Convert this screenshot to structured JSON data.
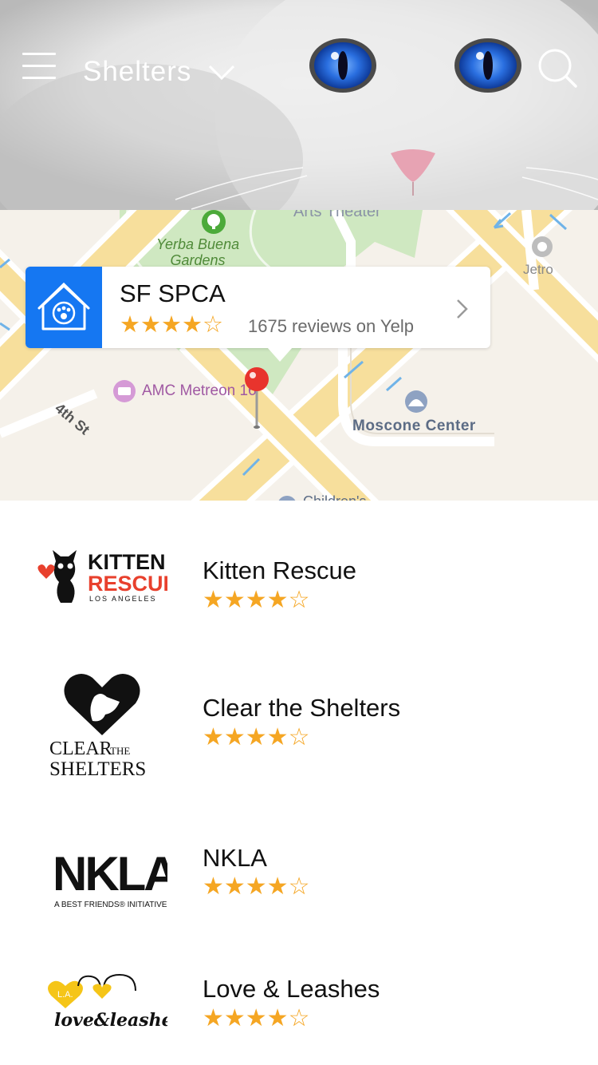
{
  "header": {
    "title": "Shelters"
  },
  "map": {
    "labels": {
      "arts": "Arts Theater",
      "yerba_line1": "Yerba Buena",
      "yerba_line2": "Gardens",
      "jetro": "Jetro",
      "amc": "AMC Metreon 16",
      "fourth_st": "4th St",
      "moscone": "Moscone Center",
      "child": "Children's"
    },
    "callout": {
      "name": "SF SPCA",
      "stars": "★★★★☆",
      "reviews": "1675 reviews on Yelp"
    }
  },
  "list": {
    "items": [
      {
        "name": "Kitten Rescue",
        "stars": "★★★★☆",
        "logo_text_top": "KITTEN",
        "logo_text_bottom": "RESCUE",
        "logo_sub": "LOS ANGELES"
      },
      {
        "name": "Clear the Shelters",
        "stars": "★★★★☆",
        "logo_text_top": "CLEAR",
        "logo_text_the": "THE",
        "logo_text_bottom": "SHELTERS"
      },
      {
        "name": "NKLA",
        "stars": "★★★★☆",
        "logo_text_top": "NKLA",
        "logo_sub": "A BEST FRIENDS® INITIATIVE"
      },
      {
        "name": "Love & Leashes",
        "stars": "★★★★☆",
        "logo_text_top": "L.A.",
        "logo_text_bottom": "love&leashes"
      }
    ]
  },
  "colors": {
    "accent_blue": "#1577f2",
    "star": "#f5a623",
    "pin": "#e8342d"
  }
}
